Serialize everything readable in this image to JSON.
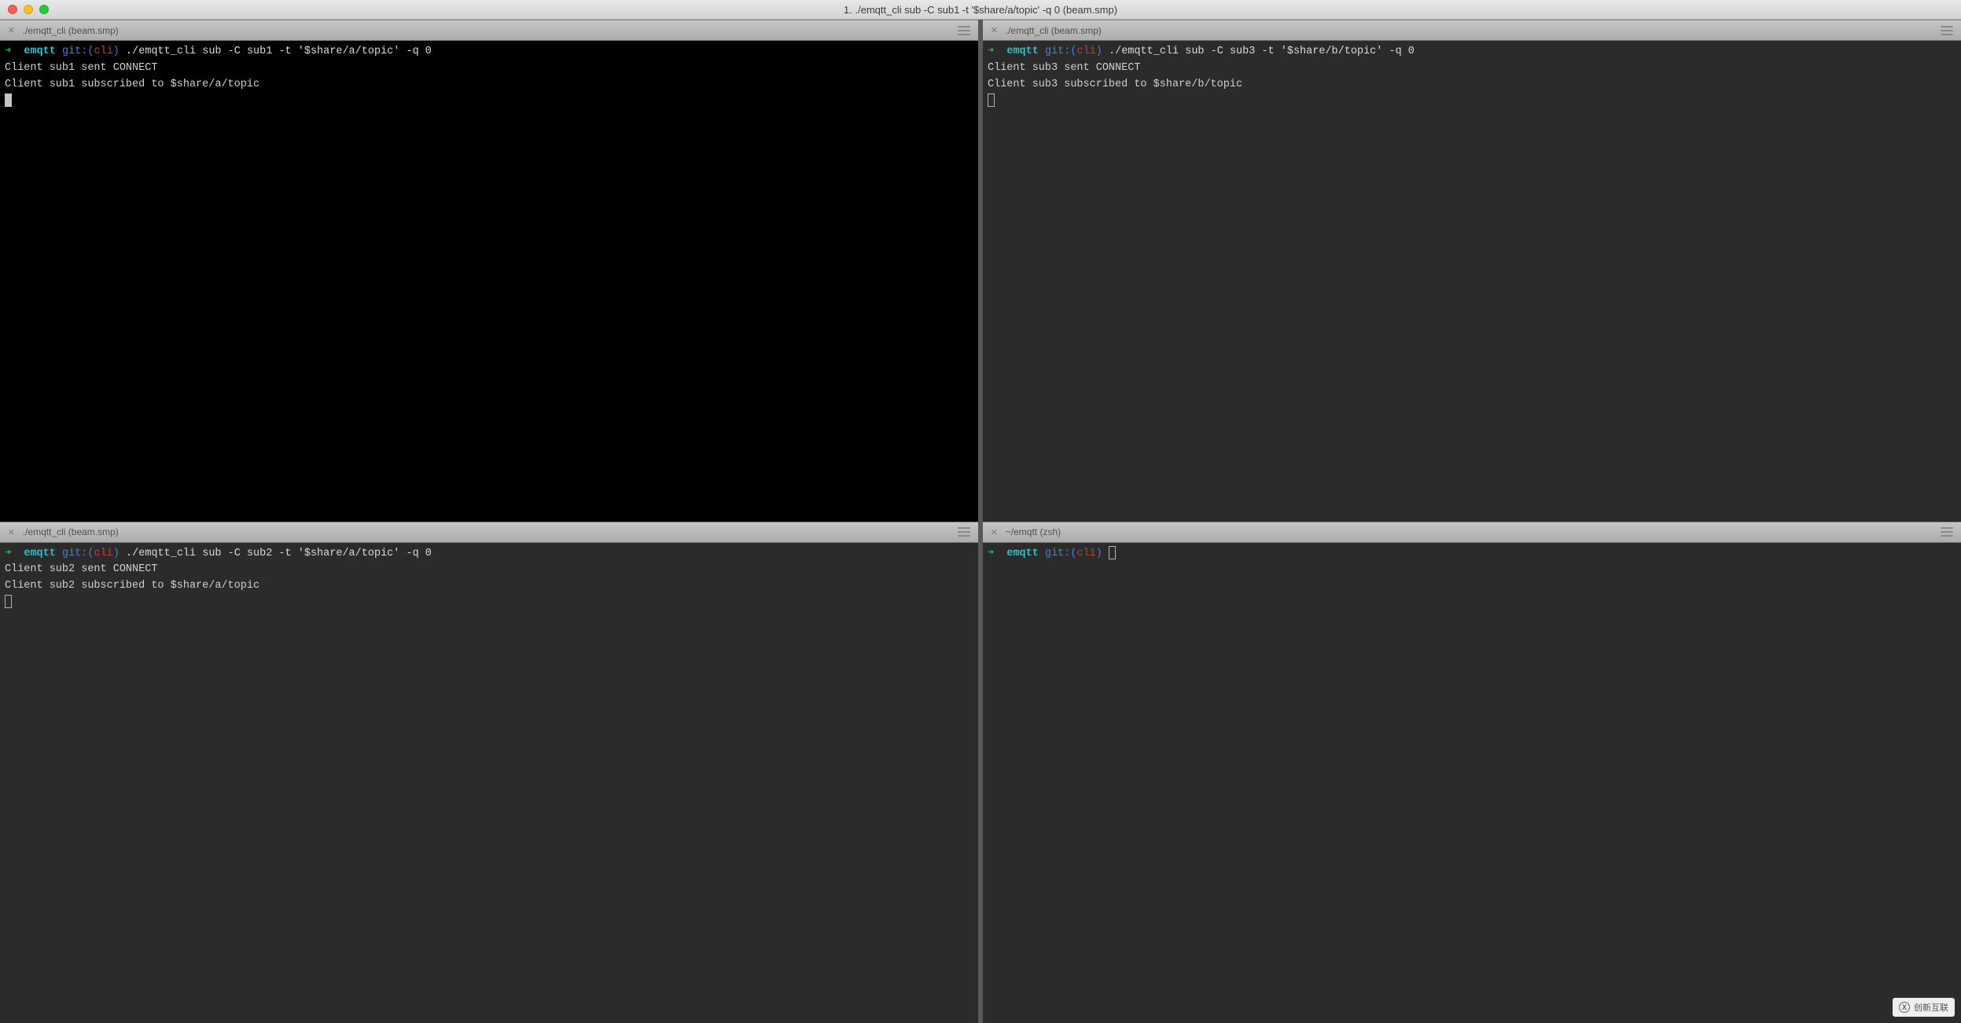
{
  "window_title": "1. ./emqtt_cli sub -C sub1 -t '$share/a/topic' -q 0 (beam.smp)",
  "panes": [
    {
      "tab_title": "./emqtt_cli (beam.smp)",
      "prompt_arrow": "➜",
      "project": "emqtt",
      "git_label": "git:(",
      "branch": "cli",
      "git_close": ")",
      "command": "./emqtt_cli sub -C sub1 -t '$share/a/topic' -q 0",
      "out1": "Client sub1 sent CONNECT",
      "out2": "Client sub1 subscribed to $share/a/topic",
      "cursor": "block"
    },
    {
      "tab_title": "./emqtt_cli (beam.smp)",
      "prompt_arrow": "➜",
      "project": "emqtt",
      "git_label": "git:(",
      "branch": "cli",
      "git_close": ")",
      "command": "./emqtt_cli sub -C sub3 -t '$share/b/topic' -q 0",
      "out1": "Client sub3 sent CONNECT",
      "out2": "Client sub3 subscribed to $share/b/topic",
      "cursor": "hollow"
    },
    {
      "tab_title": "./emqtt_cli (beam.smp)",
      "prompt_arrow": "➜",
      "project": "emqtt",
      "git_label": "git:(",
      "branch": "cli",
      "git_close": ")",
      "command": "./emqtt_cli sub -C sub2 -t '$share/a/topic' -q 0",
      "out1": "Client sub2 sent CONNECT",
      "out2": "Client sub2 subscribed to $share/a/topic",
      "cursor": "hollow"
    },
    {
      "tab_title": "~/emqtt (zsh)",
      "prompt_arrow": "➜",
      "project": "emqtt",
      "git_label": "git:(",
      "branch": "cli",
      "git_close": ")",
      "command": "",
      "out1": "",
      "out2": "",
      "cursor": "hollow-inline"
    }
  ],
  "watermark_text": "创新互联"
}
